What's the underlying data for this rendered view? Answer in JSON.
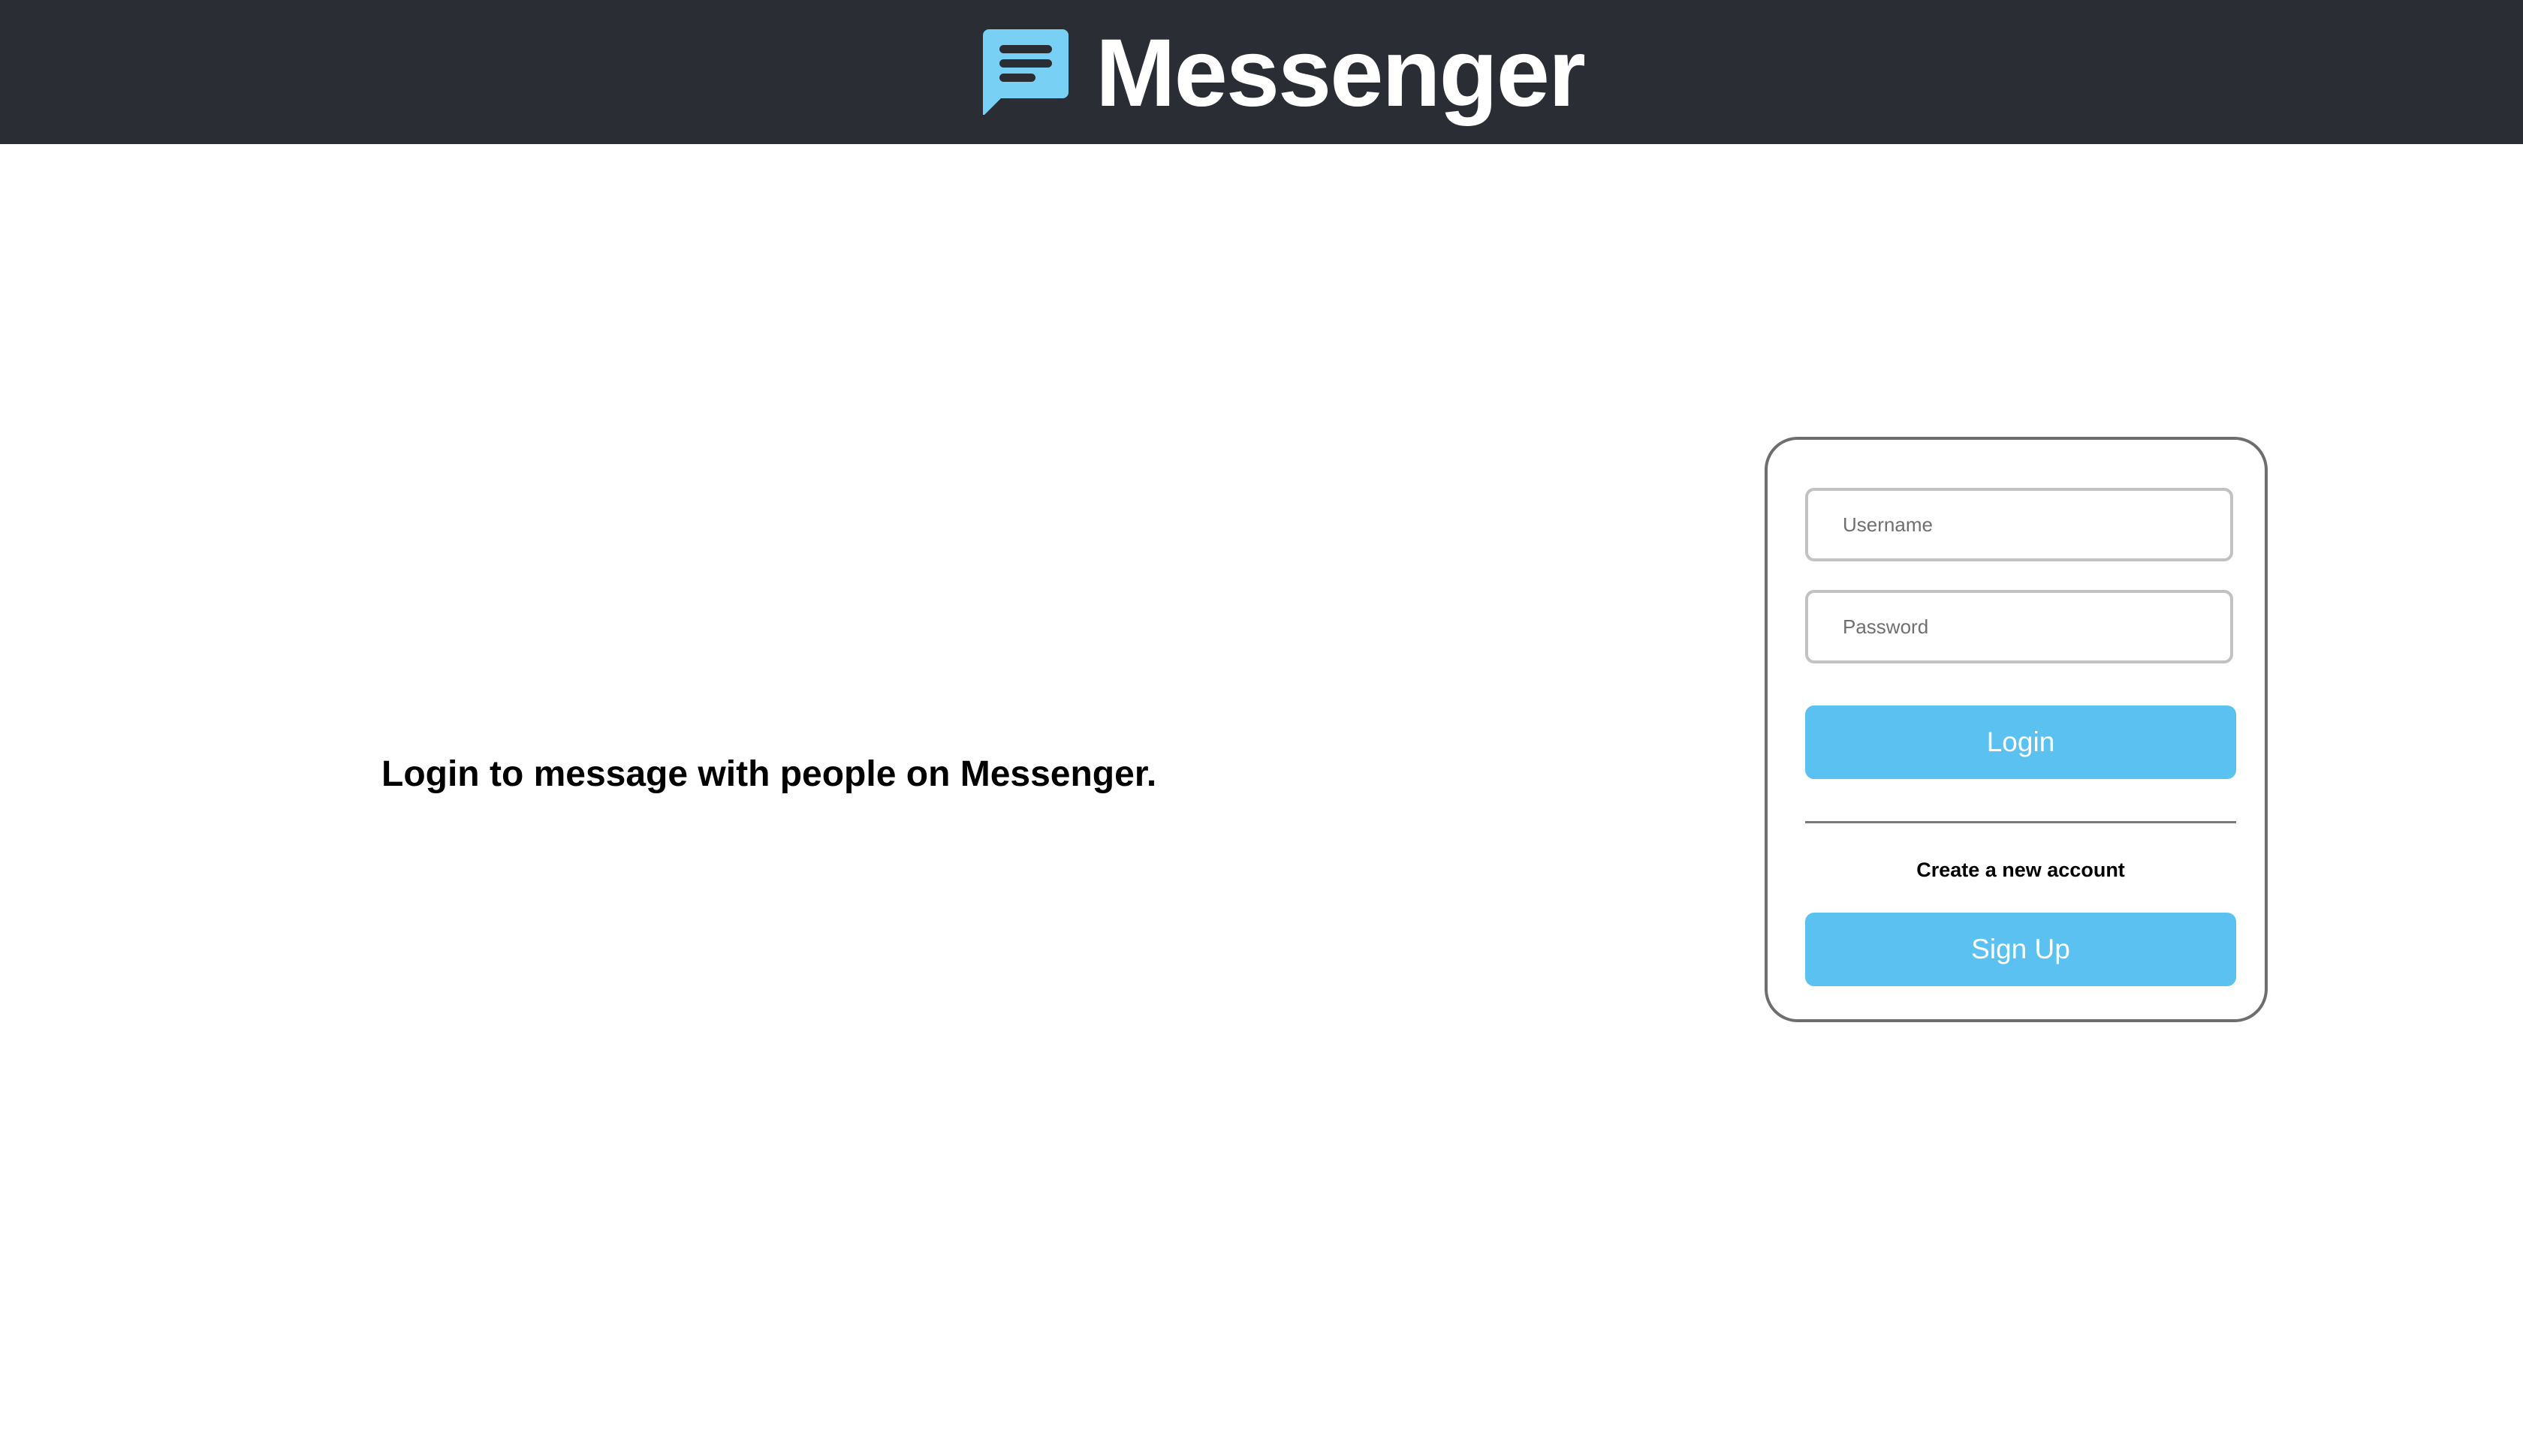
{
  "header": {
    "app_name": "Messenger",
    "logo_icon": "chat-bubble-icon",
    "background": "#2a2d34",
    "logo_color": "#79d0f5"
  },
  "main": {
    "tagline": "Login to message with people on Messenger."
  },
  "login_card": {
    "username_placeholder": "Username",
    "password_placeholder": "Password",
    "login_label": "Login",
    "create_account_text": "Create a new account",
    "signup_label": "Sign Up",
    "button_color": "#5bc1f0"
  }
}
